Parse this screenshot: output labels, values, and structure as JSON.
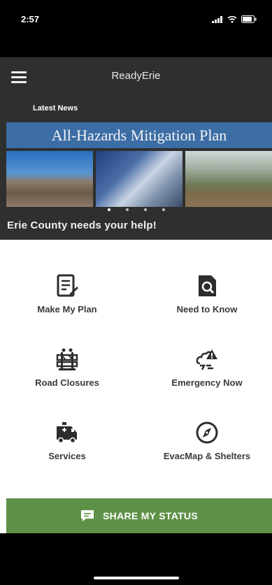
{
  "status_bar": {
    "time": "2:57",
    "icons": [
      "signal-icon",
      "wifi-icon",
      "battery-icon"
    ]
  },
  "app_bar": {
    "title": "ReadyErie",
    "menu_icon": "hamburger-menu-icon"
  },
  "news": {
    "section_label": "Latest News",
    "banner_title": "All-Hazards Mitigation Plan",
    "caption": "Erie County needs your help!",
    "carousel_pages": 4,
    "active_page": 1
  },
  "menu": {
    "items": [
      {
        "label": "Make My Plan",
        "icon": "checklist-icon"
      },
      {
        "label": "Need to Know",
        "icon": "search-document-icon"
      },
      {
        "label": "Road Closures",
        "icon": "road-barrier-icon"
      },
      {
        "label": "Emergency Now",
        "icon": "weather-alert-icon"
      },
      {
        "label": "Services",
        "icon": "ambulance-icon"
      },
      {
        "label": "EvacMap & Shelters",
        "icon": "compass-icon"
      }
    ]
  },
  "share": {
    "label": "SHARE MY STATUS",
    "icon": "chat-bubble-icon"
  },
  "colors": {
    "appbar": "#2f2f2f",
    "banner": "#3c6da5",
    "share_green": "#5e9147",
    "label_text": "#3a3a3a"
  }
}
